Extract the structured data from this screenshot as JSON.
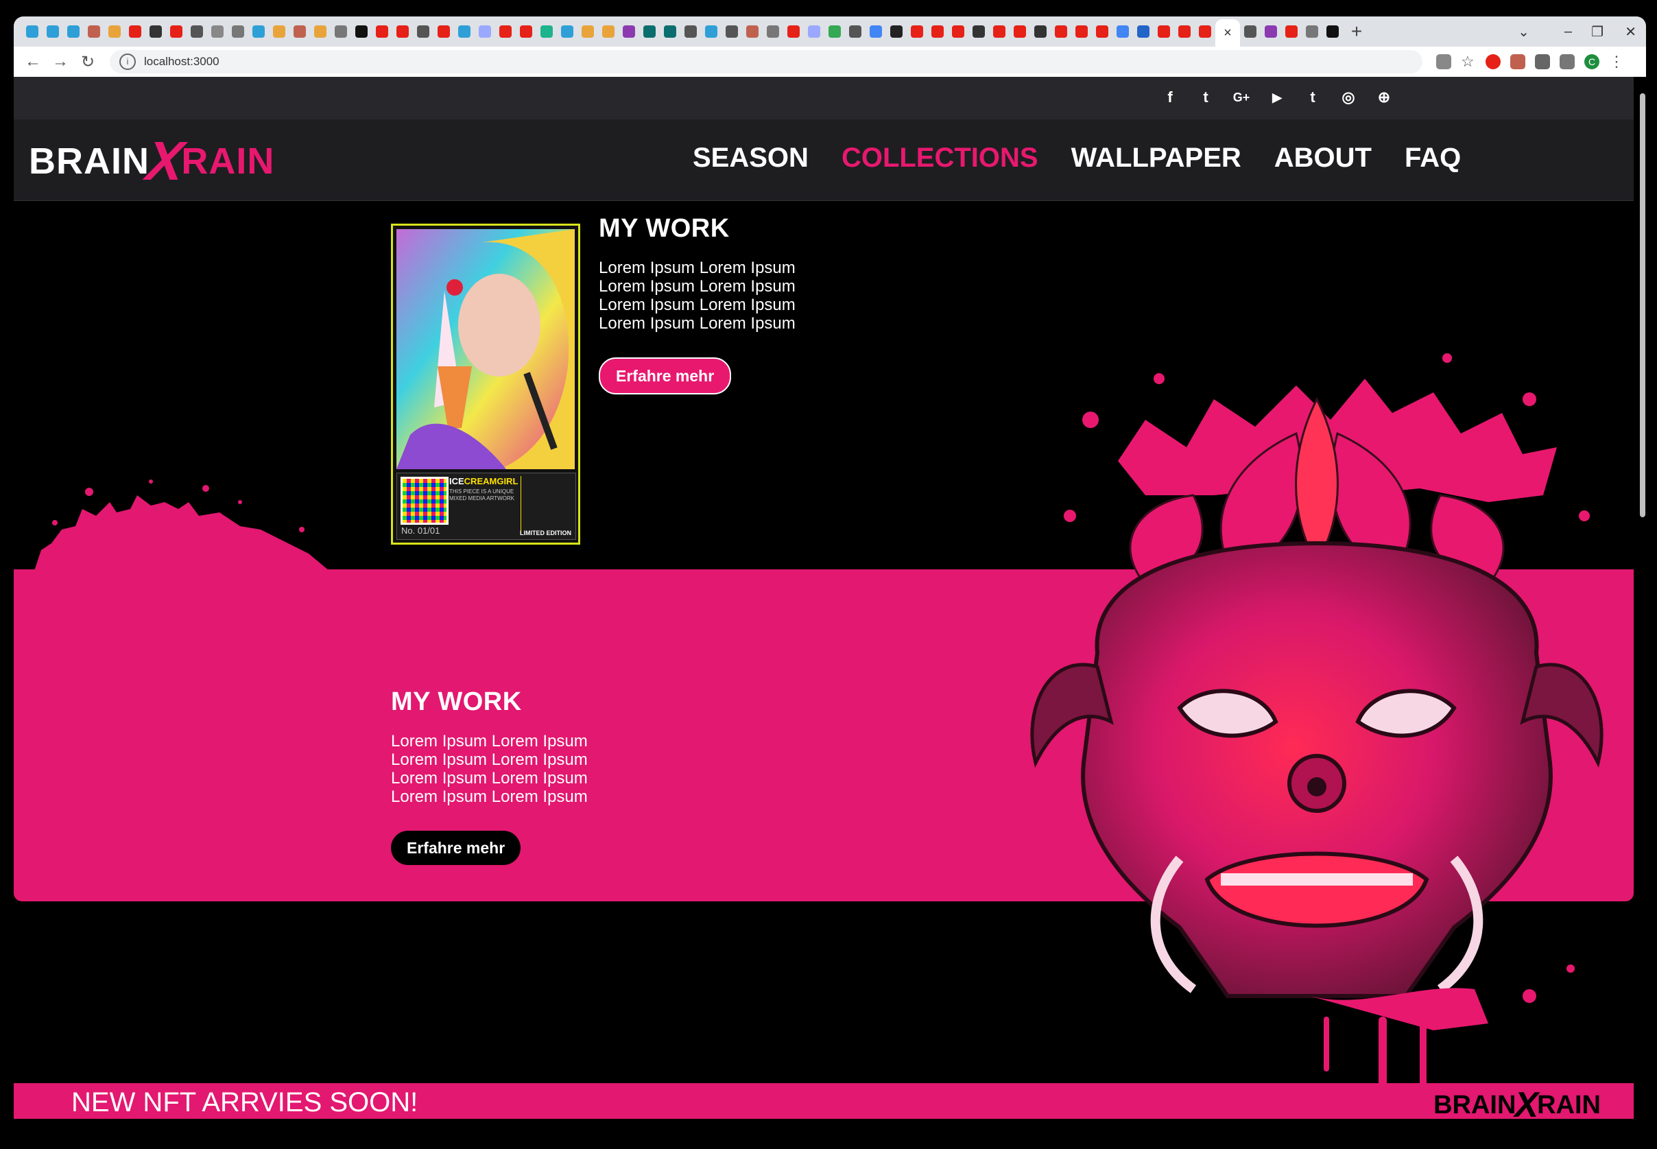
{
  "browser": {
    "url": "localhost:3000",
    "favicons": [
      "#2f9fd8",
      "#2f9fd8",
      "#2f9fd8",
      "#c0614f",
      "#e8a43b",
      "#e62117",
      "#333",
      "#e62117",
      "#555",
      "#888",
      "#777",
      "#2f9fd8",
      "#e8a43b",
      "#c0614f",
      "#e8a43b",
      "#777",
      "#111",
      "#e62117",
      "#e62117",
      "#555",
      "#e62117",
      "#2f9fd8",
      "#9aa9ff",
      "#e62117",
      "#e62117",
      "#1db38c",
      "#2f9fd8",
      "#e8a43b",
      "#e8a43b",
      "#8b3ab0",
      "#0b6e6e",
      "#0b6e6e",
      "#555",
      "#2f9fd8",
      "#555",
      "#c0614f",
      "#777",
      "#e62117",
      "#9aa9ff",
      "#34a853",
      "#555",
      "#4285f4",
      "#222",
      "#e62117",
      "#e62117",
      "#e62117",
      "#333",
      "#e62117",
      "#e62117",
      "#333",
      "#e62117",
      "#e62117",
      "#e62117",
      "#4285f4",
      "#2264c8",
      "#e62117",
      "#e62117",
      "#e62117",
      "#555",
      "#8b3ab0",
      "#e62117",
      "#777",
      "#111"
    ],
    "active_tab_close": "×",
    "new_tab": "+",
    "controls": {
      "minimize": "–",
      "restore": "❐",
      "close": "✕"
    },
    "profile_initial": "C"
  },
  "header": {
    "socials": [
      "f",
      "t",
      "G+",
      "▶",
      "t",
      "◎",
      "⊕"
    ],
    "logo": {
      "left": "BRAIN",
      "x": "X",
      "right": "RAIN"
    },
    "nav": [
      {
        "label": "SEASON",
        "active": false
      },
      {
        "label": "COLLECTIONS",
        "active": true
      },
      {
        "label": "WALLPAPER",
        "active": false
      },
      {
        "label": "ABOUT",
        "active": false
      },
      {
        "label": "FAQ",
        "active": false
      }
    ]
  },
  "artwork_card": {
    "title_a": "ICE",
    "title_b": "CREAMGIRL",
    "subtitle": "THIS PIECE IS A UNIQUE MIXED MEDIA ARTWORK",
    "number": "No. 01/01",
    "edition": "LIMITED EDITION"
  },
  "section1": {
    "title": "MY WORK",
    "lines": [
      "Lorem Ipsum Lorem Ipsum",
      "Lorem Ipsum Lorem Ipsum",
      "Lorem Ipsum Lorem Ipsum",
      "Lorem Ipsum Lorem Ipsum"
    ],
    "button": "Erfahre mehr"
  },
  "section2": {
    "title": "MY WORK",
    "lines": [
      "Lorem Ipsum Lorem Ipsum",
      "Lorem Ipsum Lorem Ipsum",
      "Lorem Ipsum Lorem Ipsum",
      "Lorem Ipsum Lorem Ipsum"
    ],
    "button": "Erfahre mehr"
  },
  "footer": {
    "news": "NEW NFT ARRVIES SOON!",
    "logo": {
      "left": "BRAIN",
      "x": "X",
      "right": "RAIN"
    }
  },
  "colors": {
    "accent": "#e8186f",
    "band": "#e31870",
    "topbar": "#28282c",
    "nav": "#1e1e21"
  }
}
